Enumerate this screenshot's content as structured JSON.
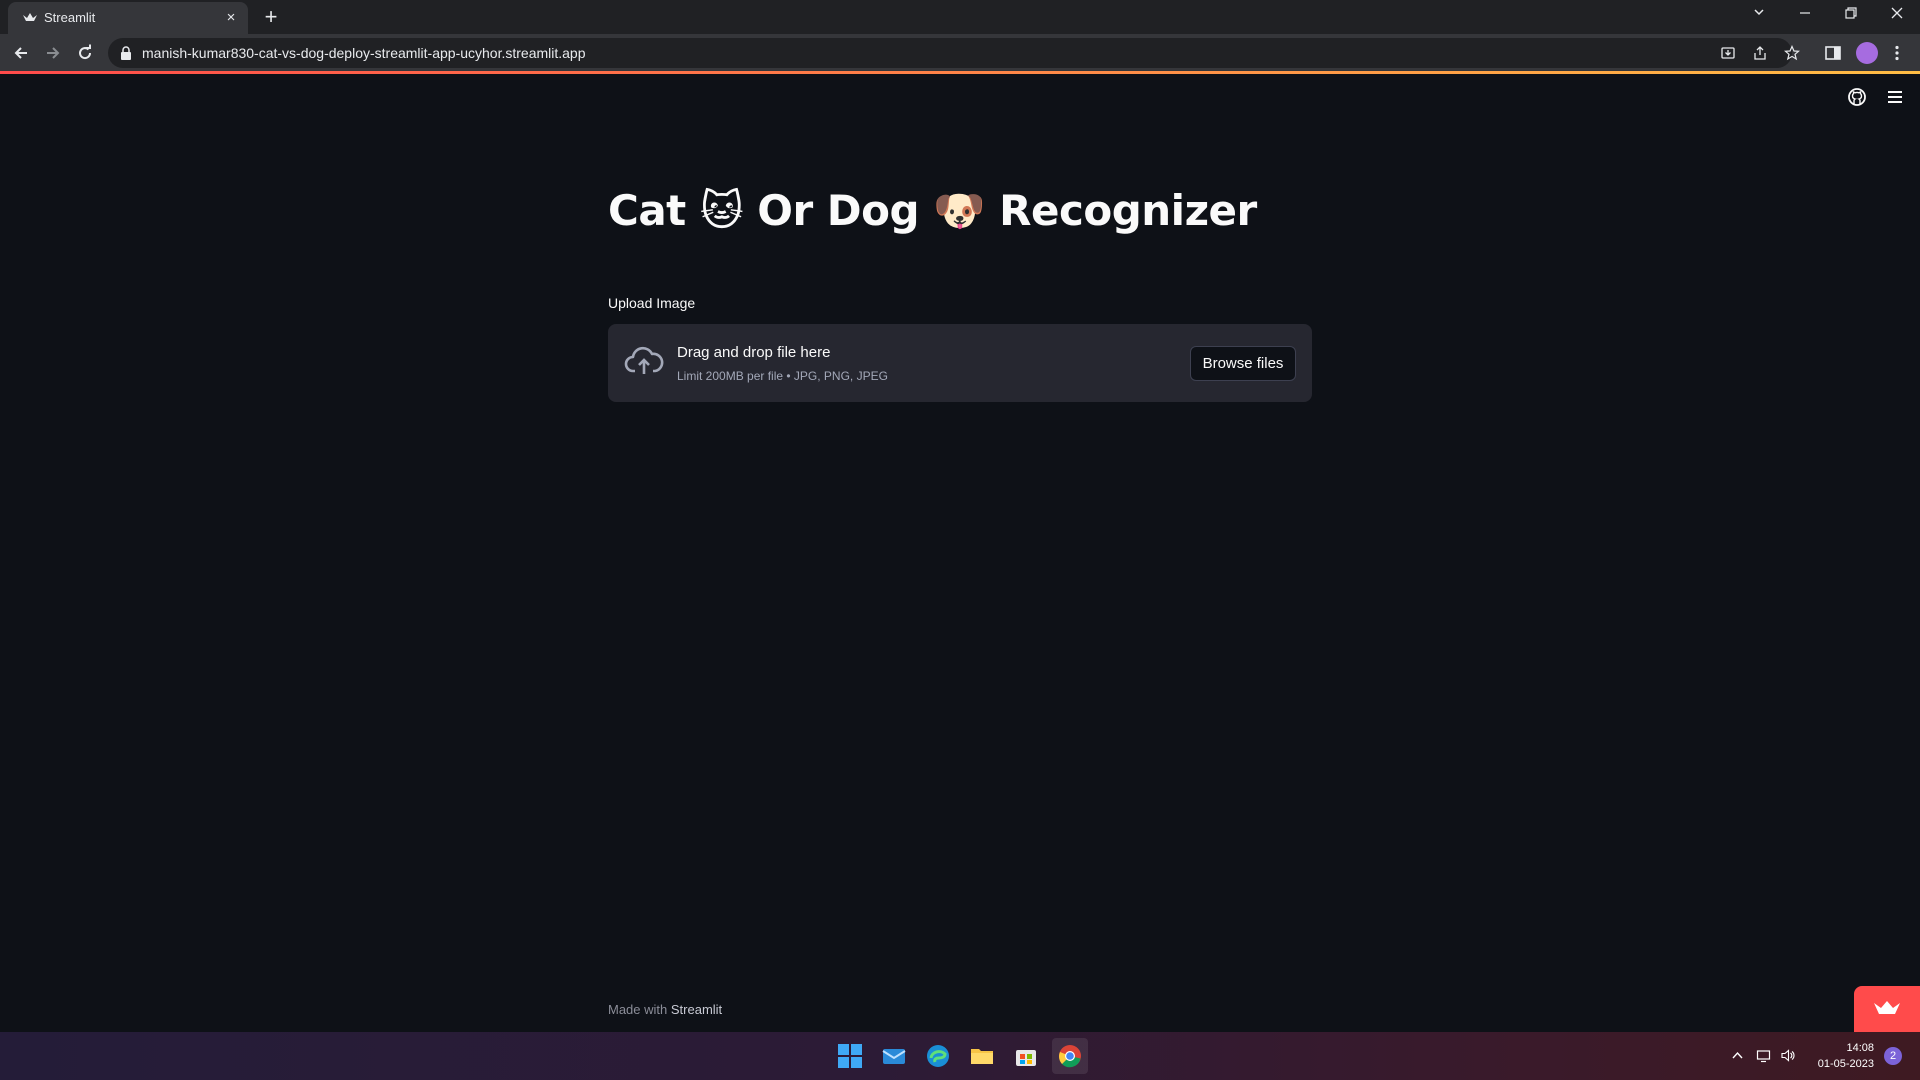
{
  "browser": {
    "tab_title": "Streamlit",
    "tab_close": "×",
    "new_tab": "+",
    "url": "manish-kumar830-cat-vs-dog-deploy-streamlit-app-ucyhor.streamlit.app"
  },
  "app": {
    "title": "Cat 🐱 Or Dog 🐶 Recognizer",
    "upload_label": "Upload Image",
    "dropzone_title": "Drag and drop file here",
    "dropzone_subtitle": "Limit 200MB per file • JPG, PNG, JPEG",
    "browse_button": "Browse files",
    "footer_prefix": "Made with ",
    "footer_link": "Streamlit"
  },
  "taskbar": {
    "time": "14:08",
    "date": "01-05-2023",
    "notification_count": "2"
  },
  "colors": {
    "app_background": "#0e1117",
    "dropzone_background": "#262730",
    "accent": "#ff4b4b"
  }
}
